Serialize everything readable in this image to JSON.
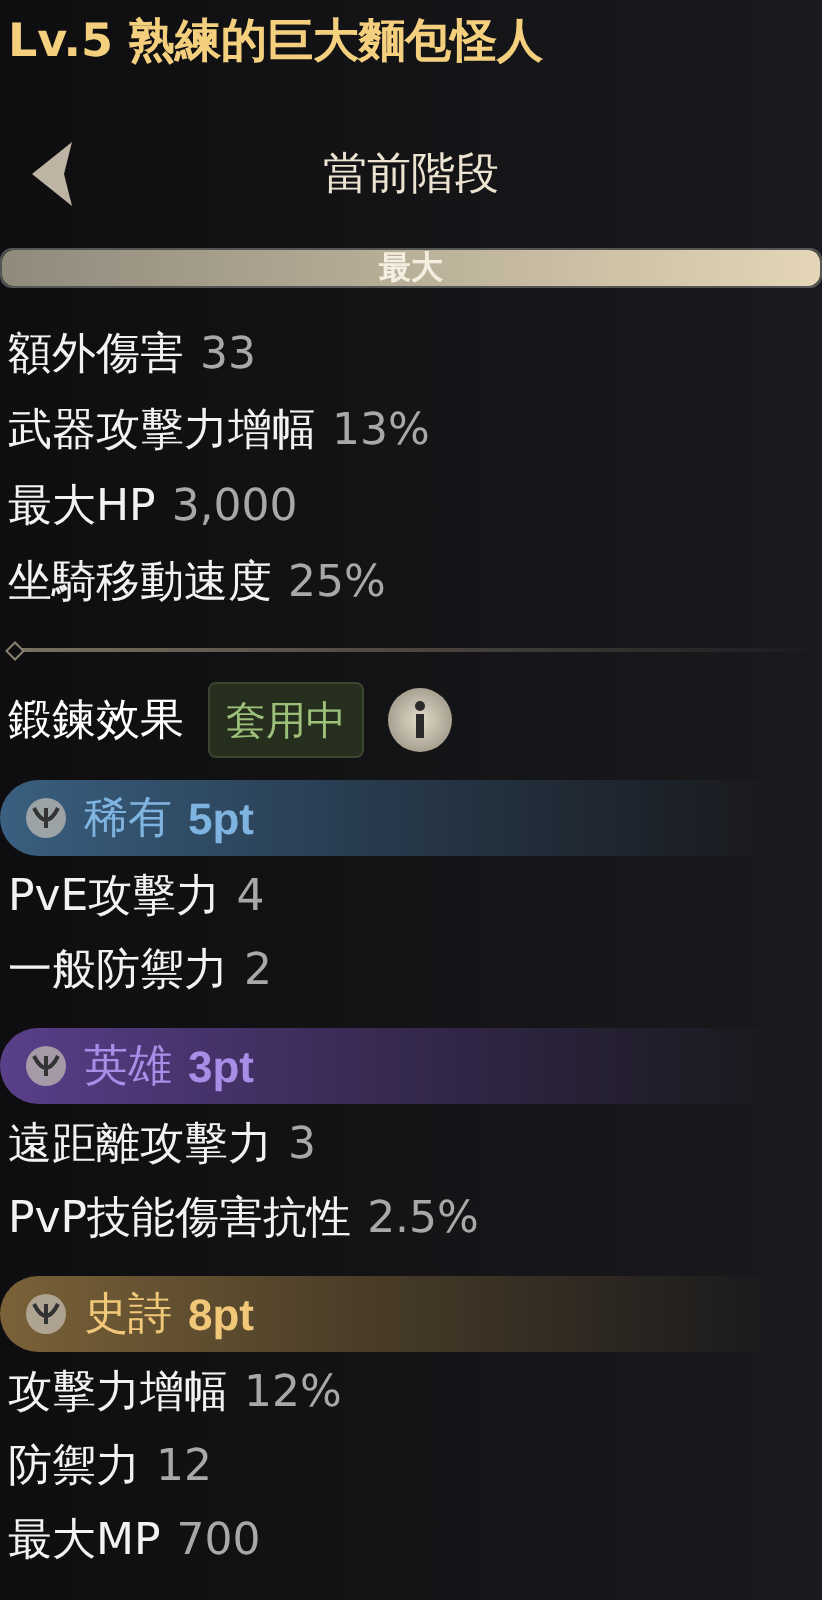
{
  "title": "Lv.5 熟練的巨大麵包怪人",
  "header": {
    "title": "當前階段"
  },
  "stage_bar": {
    "label": "最大",
    "level": 1
  },
  "stats": [
    {
      "name": "額外傷害",
      "value": "33"
    },
    {
      "name": "武器攻擊力增幅",
      "value": "13%"
    },
    {
      "name": "最大HP",
      "value": "3,000"
    },
    {
      "name": "坐騎移動速度",
      "value": "25%"
    }
  ],
  "forging": {
    "label": "鍛鍊效果",
    "badge": "套用中"
  },
  "tiers": [
    {
      "name": "稀有",
      "points": "5pt",
      "color": "#3a5f80",
      "stats": [
        {
          "name": "PvE攻擊力",
          "value": "4"
        },
        {
          "name": "一般防禦力",
          "value": "2"
        }
      ]
    },
    {
      "name": "英雄",
      "points": "3pt",
      "color": "#5a3f8a",
      "stats": [
        {
          "name": "遠距離攻擊力",
          "value": "3"
        },
        {
          "name": "PvP技能傷害抗性",
          "value": "2.5%"
        }
      ]
    },
    {
      "name": "史詩",
      "points": "8pt",
      "color": "#7a6238",
      "stats": [
        {
          "name": "攻擊力增幅",
          "value": "12%"
        },
        {
          "name": "防禦力",
          "value": "12"
        },
        {
          "name": "最大MP",
          "value": "700"
        }
      ]
    }
  ]
}
